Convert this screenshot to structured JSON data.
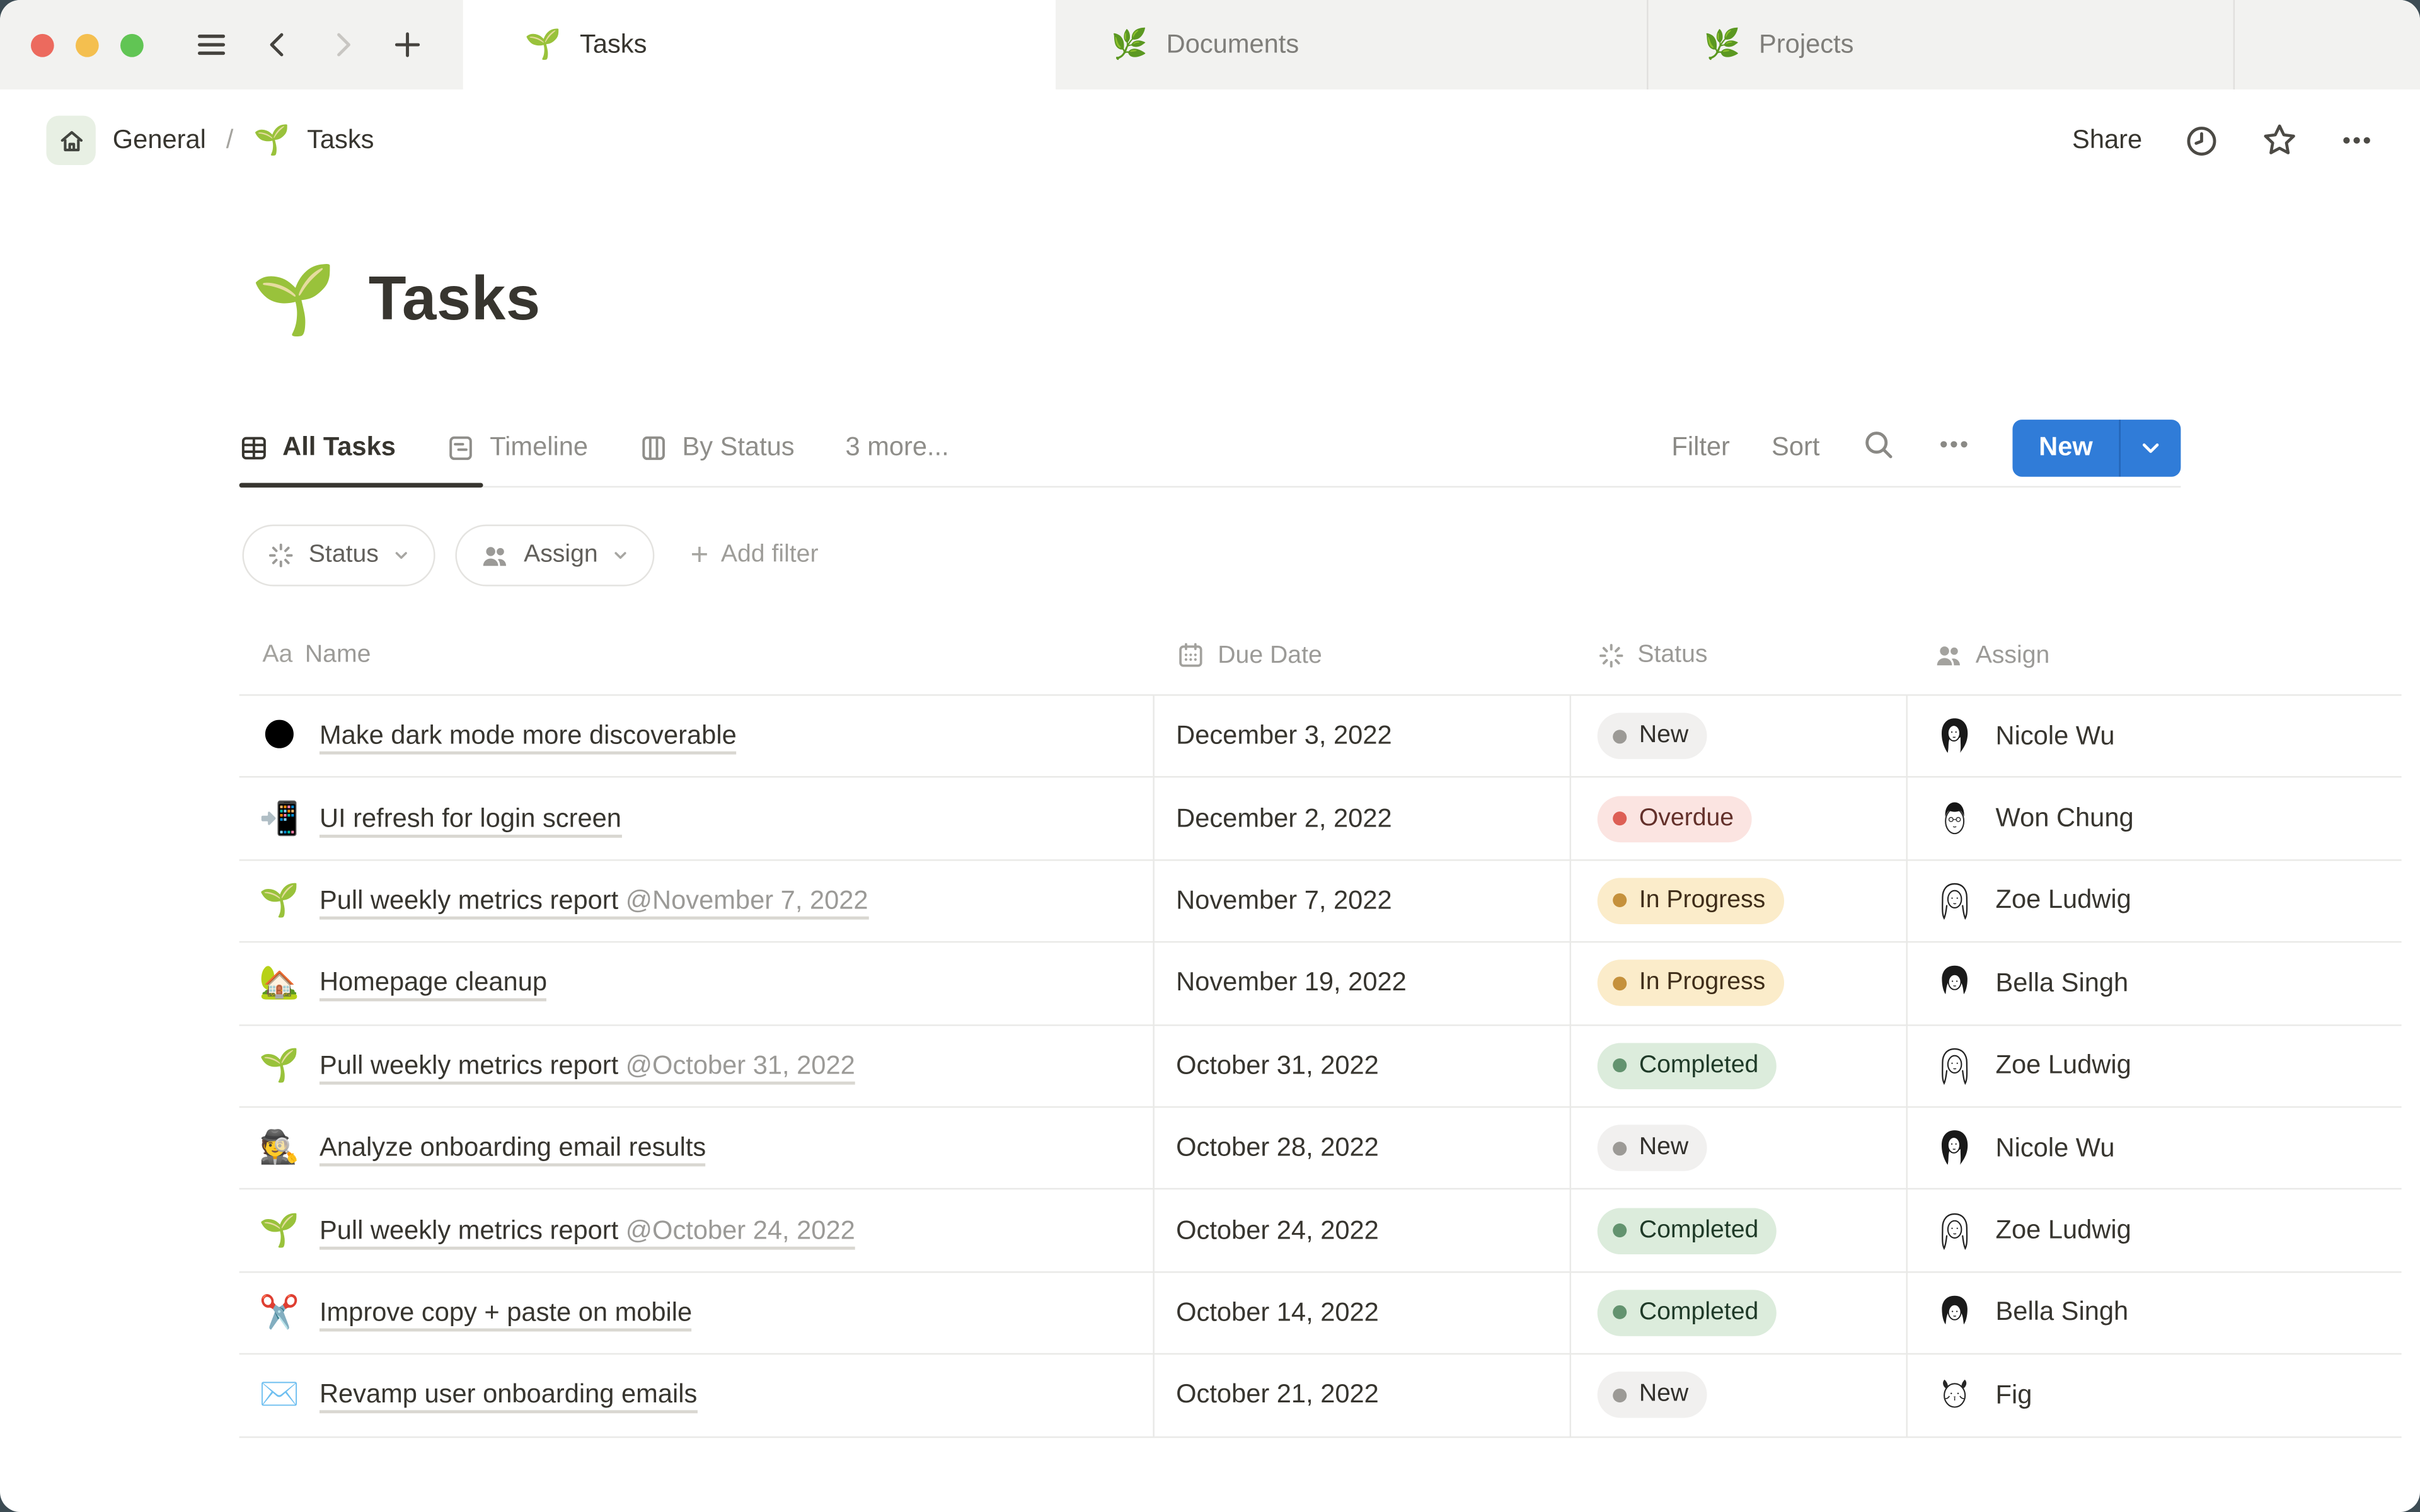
{
  "window": {
    "traffic_light_colors": {
      "close": "#ec6a5e",
      "minimize": "#f4bf4f",
      "zoom": "#61c554"
    }
  },
  "tabbar": {
    "tabs": [
      {
        "icon": "🌱",
        "label": "Tasks",
        "active": true
      },
      {
        "icon": "🌿",
        "label": "Documents",
        "active": false
      },
      {
        "icon": "🌿",
        "label": "Projects",
        "active": false
      }
    ]
  },
  "breadcrumb": {
    "teamspace": "General",
    "separator": "/",
    "page_icon": "🌱",
    "page": "Tasks"
  },
  "topbar_actions": {
    "share_label": "Share"
  },
  "page": {
    "icon": "🌱",
    "title": "Tasks"
  },
  "views": {
    "tabs": [
      {
        "icon": "table",
        "label": "All Tasks",
        "active": true
      },
      {
        "icon": "timeline",
        "label": "Timeline",
        "active": false
      },
      {
        "icon": "board",
        "label": "By Status",
        "active": false
      },
      {
        "icon": null,
        "label": "3 more...",
        "active": false
      }
    ]
  },
  "toolbar": {
    "filter_label": "Filter",
    "sort_label": "Sort",
    "new_label": "New",
    "accent_blue": "#307cd8"
  },
  "filters": {
    "chips": [
      {
        "icon": "burst",
        "label": "Status"
      },
      {
        "icon": "people",
        "label": "Assign"
      }
    ],
    "add_filter_plus": "+",
    "add_filter_label": "Add filter"
  },
  "table": {
    "columns": [
      {
        "icon": "Aa",
        "label": "Name"
      },
      {
        "icon": "calendar",
        "label": "Due Date"
      },
      {
        "icon": "burst",
        "label": "Status"
      },
      {
        "icon": "people",
        "label": "Assign"
      }
    ],
    "rows": [
      {
        "emoji": "🌑",
        "name": "Make dark mode more discoverable",
        "mention": "",
        "due": "December 3, 2022",
        "status": "New",
        "assignee": "Nicole Wu",
        "avatar": "nicole"
      },
      {
        "emoji": "📲",
        "name": "UI refresh for login screen",
        "mention": "",
        "due": "December 2, 2022",
        "status": "Overdue",
        "assignee": "Won Chung",
        "avatar": "won"
      },
      {
        "emoji": "🌱",
        "name": "Pull weekly metrics report",
        "mention": "@November 7, 2022",
        "due": "November 7, 2022",
        "status": "In Progress",
        "assignee": "Zoe Ludwig",
        "avatar": "zoe"
      },
      {
        "emoji": "🏡",
        "name": "Homepage cleanup",
        "mention": "",
        "due": "November 19, 2022",
        "status": "In Progress",
        "assignee": "Bella Singh",
        "avatar": "bella"
      },
      {
        "emoji": "🌱",
        "name": "Pull weekly metrics report",
        "mention": "@October 31, 2022",
        "due": "October 31, 2022",
        "status": "Completed",
        "assignee": "Zoe Ludwig",
        "avatar": "zoe"
      },
      {
        "emoji": "🕵️",
        "name": "Analyze onboarding email results",
        "mention": "",
        "due": "October 28, 2022",
        "status": "New",
        "assignee": "Nicole Wu",
        "avatar": "nicole"
      },
      {
        "emoji": "🌱",
        "name": "Pull weekly metrics report",
        "mention": "@October 24, 2022",
        "due": "October 24, 2022",
        "status": "Completed",
        "assignee": "Zoe Ludwig",
        "avatar": "zoe"
      },
      {
        "emoji": "✂️",
        "name": "Improve copy + paste on mobile",
        "mention": "",
        "due": "October 14, 2022",
        "status": "Completed",
        "assignee": "Bella Singh",
        "avatar": "bella"
      },
      {
        "emoji": "✉️",
        "name": "Revamp user onboarding emails",
        "mention": "",
        "due": "October 21, 2022",
        "status": "New",
        "assignee": "Fig",
        "avatar": "fig"
      }
    ]
  },
  "status_styles": {
    "New": {
      "bg": "#f1f0ef",
      "dot": "#9c9a96",
      "text": "#32302c"
    },
    "Overdue": {
      "bg": "#fbe4e1",
      "dot": "#dd5f55",
      "text": "#63302a"
    },
    "In Progress": {
      "bg": "#fbecca",
      "dot": "#c5913c",
      "text": "#3f2d19"
    },
    "Completed": {
      "bg": "#dcecdc",
      "dot": "#63936f",
      "text": "#1f3a28"
    }
  }
}
